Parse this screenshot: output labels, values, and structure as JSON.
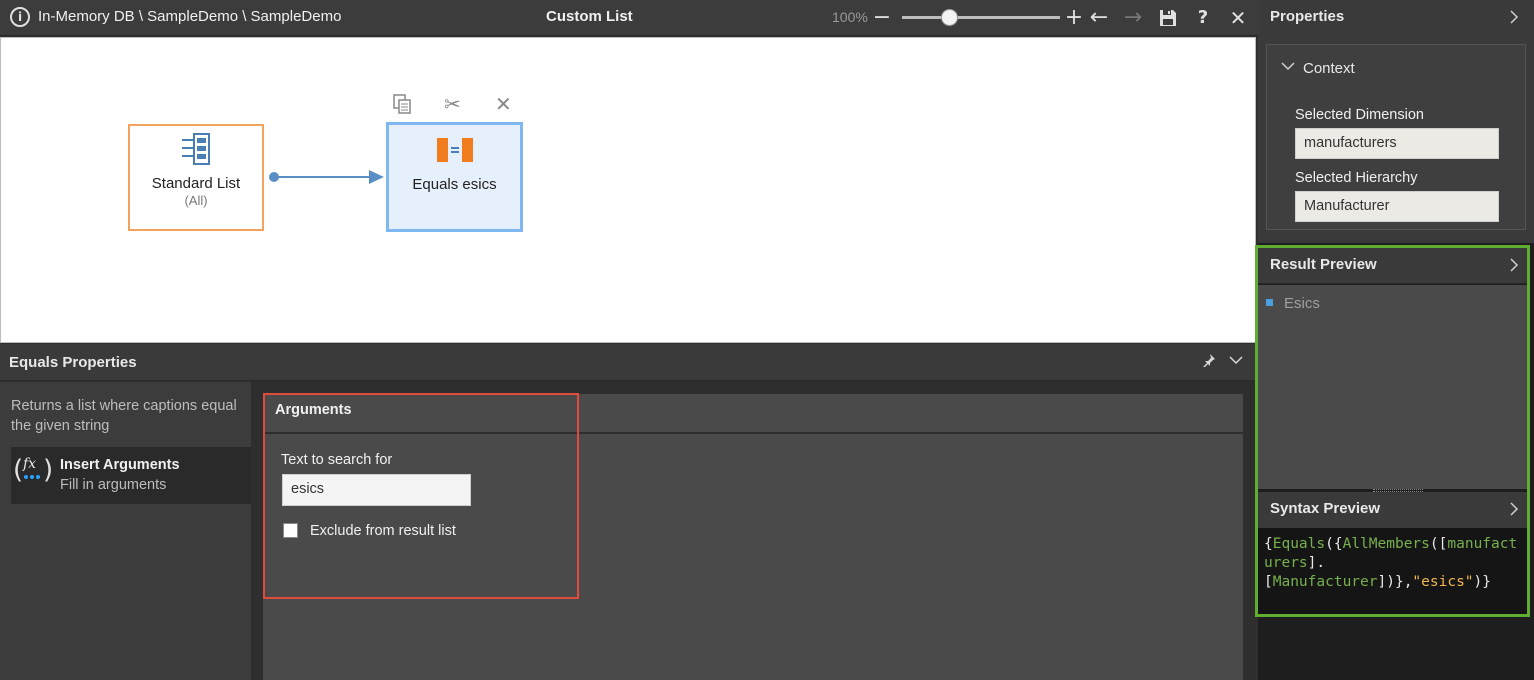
{
  "toolbar": {
    "breadcrumb": "In-Memory DB \\ SampleDemo \\ SampleDemo",
    "title": "Custom List",
    "zoom": "100%",
    "zoom_level": 0.25,
    "icons": [
      "info-icon",
      "zoom-out-icon",
      "zoom-in-icon",
      "undo-icon",
      "redo-icon",
      "save-icon",
      "help-icon",
      "close-icon"
    ]
  },
  "canvas": {
    "nodes": [
      {
        "name": "Standard List",
        "sub": "(All)",
        "icon": "list-icon",
        "border_color": "#f3a35b"
      },
      {
        "name": "Equals esics",
        "icon": "equals-icon",
        "selected": true,
        "border_color": "#7fb7f0"
      }
    ],
    "node_tools": [
      "copy-icon",
      "cut-icon",
      "delete-icon"
    ]
  },
  "equals_properties": {
    "title": "Equals Properties",
    "description": "Returns a list where captions equal the given string",
    "step": {
      "title": "Insert Arguments",
      "subtitle": "Fill in arguments"
    },
    "arguments": {
      "title": "Arguments",
      "text_label": "Text to search for",
      "text_value": "esics",
      "exclude_label": "Exclude from result list",
      "exclude_checked": false
    }
  },
  "properties_panel": {
    "title": "Properties",
    "context_title": "Context",
    "dimension_label": "Selected Dimension",
    "dimension_value": "manufacturers",
    "hierarchy_label": "Selected Hierarchy",
    "hierarchy_value": "Manufacturer"
  },
  "result_preview": {
    "title": "Result Preview",
    "items": [
      "Esics"
    ]
  },
  "syntax_preview": {
    "title": "Syntax Preview",
    "p1": "{",
    "fn1": "Equals",
    "p2": "({",
    "fn2": "AllMembers",
    "p3": "([",
    "fn3": "manufacturers",
    "p4": "].\n[",
    "fn4": "Manufacturer",
    "p5": "])},",
    "str": "\"esics\"",
    "p6": ")}"
  },
  "colors": {
    "highlight_red": "#e04b3c",
    "highlight_green": "#5fae31",
    "accent_blue": "#4a9fe0"
  }
}
